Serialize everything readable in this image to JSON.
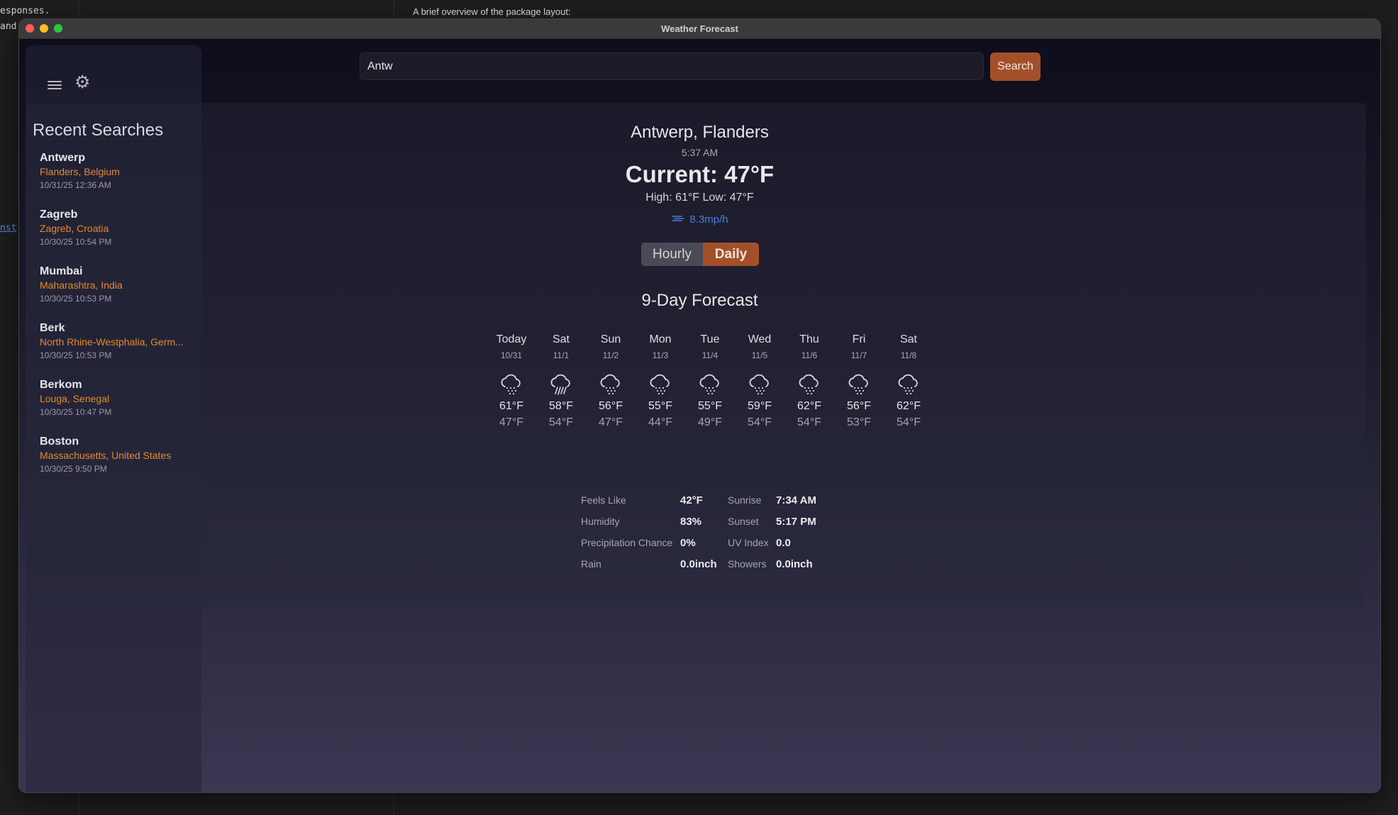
{
  "background": {
    "terminal_lines": [
      "esponses.",
      "and"
    ],
    "link_text": "nst",
    "doc_text": "A brief overview of the package layout:"
  },
  "window": {
    "title": "Weather Forecast"
  },
  "sidebar": {
    "recent_title": "Recent Searches",
    "items": [
      {
        "city": "Antwerp",
        "region": "Flanders, Belgium",
        "time": "10/31/25 12:36 AM"
      },
      {
        "city": "Zagreb",
        "region": "Zagreb, Croatia",
        "time": "10/30/25 10:54 PM"
      },
      {
        "city": "Mumbai",
        "region": "Maharashtra, India",
        "time": "10/30/25 10:53 PM"
      },
      {
        "city": "Berk",
        "region": "North Rhine-Westphalia, Germ...",
        "time": "10/30/25 10:53 PM"
      },
      {
        "city": "Berkom",
        "region": "Louga, Senegal",
        "time": "10/30/25 10:47 PM"
      },
      {
        "city": "Boston",
        "region": "Massachusetts, United States",
        "time": "10/30/25 9:50 PM"
      }
    ]
  },
  "search": {
    "value": "Antw",
    "button_label": "Search"
  },
  "weather": {
    "location": "Antwerp, Flanders",
    "local_time": "5:37 AM",
    "current": "Current: 47°F",
    "high_low": "High: 61°F Low: 47°F",
    "wind": "8.3mp/h"
  },
  "toggle": {
    "hourly": "Hourly",
    "daily": "Daily",
    "selected": "Daily"
  },
  "forecast": {
    "title": "9-Day Forecast",
    "days": [
      {
        "name": "Today",
        "date": "10/31",
        "icon": "rain-cloud-icon",
        "high": "61°F",
        "low": "47°F"
      },
      {
        "name": "Sat",
        "date": "11/1",
        "icon": "heavy-rain-cloud-icon",
        "high": "58°F",
        "low": "54°F"
      },
      {
        "name": "Sun",
        "date": "11/2",
        "icon": "rain-cloud-icon",
        "high": "56°F",
        "low": "47°F"
      },
      {
        "name": "Mon",
        "date": "11/3",
        "icon": "rain-cloud-icon",
        "high": "55°F",
        "low": "44°F"
      },
      {
        "name": "Tue",
        "date": "11/4",
        "icon": "rain-cloud-icon",
        "high": "55°F",
        "low": "49°F"
      },
      {
        "name": "Wed",
        "date": "11/5",
        "icon": "rain-cloud-icon",
        "high": "59°F",
        "low": "54°F"
      },
      {
        "name": "Thu",
        "date": "11/6",
        "icon": "rain-cloud-icon",
        "high": "62°F",
        "low": "54°F"
      },
      {
        "name": "Fri",
        "date": "11/7",
        "icon": "rain-cloud-icon",
        "high": "56°F",
        "low": "53°F"
      },
      {
        "name": "Sat",
        "date": "11/8",
        "icon": "rain-cloud-icon",
        "high": "62°F",
        "low": "54°F"
      }
    ]
  },
  "details": [
    {
      "label1": "Feels Like",
      "value1": "42°F",
      "label2": "Sunrise",
      "value2": "7:34 AM"
    },
    {
      "label1": "Humidity",
      "value1": "83%",
      "label2": "Sunset",
      "value2": "5:17 PM"
    },
    {
      "label1": "Precipitation Chance",
      "value1": "0%",
      "label2": "UV Index",
      "value2": "0.0"
    },
    {
      "label1": "Rain",
      "value1": "0.0inch",
      "label2": "Showers",
      "value2": "0.0inch"
    }
  ],
  "colors": {
    "accent": "#a3502a",
    "region_text": "#e28a2c",
    "wind_text": "#4a7fe0"
  }
}
